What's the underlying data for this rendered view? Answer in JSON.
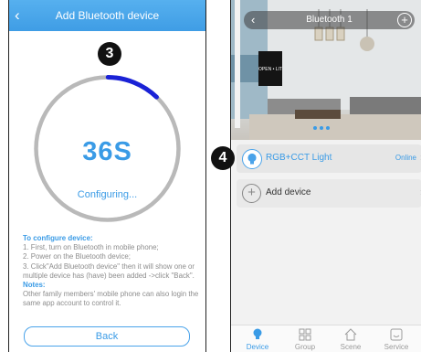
{
  "left": {
    "header": {
      "back_icon": "chevron-left-icon",
      "title": "Add Bluetooth device"
    },
    "step_badge": "3",
    "countdown": "36S",
    "status": "Configuring...",
    "info": {
      "heading": "To configure device:",
      "lines": [
        "1. First, turn on Bluetooth in mobile phone;",
        "2. Power on the Bluetooth device;",
        "3. Click\"Add Bluetooth device\" then it will show one or multiple device has (have) been added ->click \"Back\"."
      ],
      "notes_heading": "Notes:",
      "notes_text": "Other family members' mobile phone can also login the same app account to control it."
    },
    "back_button": "Back",
    "accent": "#3a9be6",
    "progress_fraction": 0.12
  },
  "right": {
    "header": {
      "back_icon": "chevron-left-icon",
      "title": "Bluetooth 1",
      "add_icon": "plus-circle-icon"
    },
    "photo_sign": "OPEN • LIT",
    "step_badge": "4",
    "devices": [
      {
        "name": "RGB+CCT Light",
        "status": "Online",
        "icon": "bulb-icon"
      },
      {
        "name": "Add device",
        "icon": "plus-circle-icon"
      }
    ],
    "tabs": [
      {
        "label": "Device",
        "icon": "bulb-icon",
        "active": true
      },
      {
        "label": "Group",
        "icon": "grid-icon"
      },
      {
        "label": "Scene",
        "icon": "home-icon"
      },
      {
        "label": "Service",
        "icon": "message-icon"
      }
    ]
  }
}
